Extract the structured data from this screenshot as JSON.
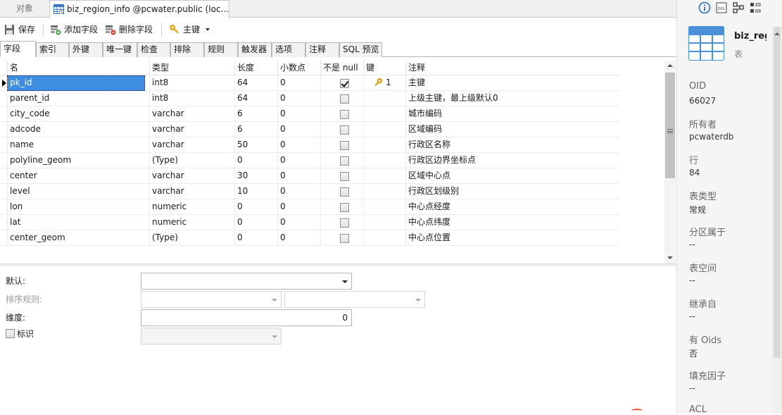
{
  "tabs": {
    "objects": "对象",
    "active": "biz_region_info @pcwater.public (loc..."
  },
  "toolbar": {
    "save": "保存",
    "add_field": "添加字段",
    "delete_field": "删除字段",
    "primary_key": "主键"
  },
  "subtabs": [
    "字段",
    "索引",
    "外键",
    "唯一键",
    "检查",
    "排除",
    "规则",
    "触发器",
    "选项",
    "注释",
    "SQL 预览"
  ],
  "grid": {
    "headers": [
      "名",
      "类型",
      "长度",
      "小数点",
      "不是 null",
      "键",
      "注释"
    ],
    "rows": [
      {
        "name": "pk_id",
        "type": "int8",
        "length": "64",
        "decimal": "0",
        "not_null": true,
        "key": "1",
        "comment": "主键"
      },
      {
        "name": "parent_id",
        "type": "int8",
        "length": "64",
        "decimal": "0",
        "not_null": false,
        "key": "",
        "comment": "上级主键，最上级默认0"
      },
      {
        "name": "city_code",
        "type": "varchar",
        "length": "6",
        "decimal": "0",
        "not_null": false,
        "key": "",
        "comment": "城市编码"
      },
      {
        "name": "adcode",
        "type": "varchar",
        "length": "6",
        "decimal": "0",
        "not_null": false,
        "key": "",
        "comment": "区域编码"
      },
      {
        "name": "name",
        "type": "varchar",
        "length": "50",
        "decimal": "0",
        "not_null": false,
        "key": "",
        "comment": "行政区名称"
      },
      {
        "name": "polyline_geom",
        "type": "(Type)",
        "length": "0",
        "decimal": "0",
        "not_null": false,
        "key": "",
        "comment": "行政区边界坐标点"
      },
      {
        "name": "center",
        "type": "varchar",
        "length": "30",
        "decimal": "0",
        "not_null": false,
        "key": "",
        "comment": "区域中心点"
      },
      {
        "name": "level",
        "type": "varchar",
        "length": "10",
        "decimal": "0",
        "not_null": false,
        "key": "",
        "comment": "行政区划级别"
      },
      {
        "name": "lon",
        "type": "numeric",
        "length": "0",
        "decimal": "0",
        "not_null": false,
        "key": "",
        "comment": "中心点经度"
      },
      {
        "name": "lat",
        "type": "numeric",
        "length": "0",
        "decimal": "0",
        "not_null": false,
        "key": "",
        "comment": "中心点纬度"
      },
      {
        "name": "center_geom",
        "type": "(Type)",
        "length": "0",
        "decimal": "0",
        "not_null": false,
        "key": "",
        "comment": "中心点位置"
      }
    ]
  },
  "props": {
    "default_label": "默认:",
    "collation_label": "排序规则:",
    "dimension_label": "维度:",
    "dimension_value": "0",
    "identity_label": "标识"
  },
  "info": {
    "object_name": "biz_region_info",
    "object_type": "表",
    "fields": [
      {
        "label": "OID",
        "value": "66027"
      },
      {
        "label": "所有者",
        "value": "pcwaterdb"
      },
      {
        "label": "行",
        "value": "84"
      },
      {
        "label": "表类型",
        "value": "常规"
      },
      {
        "label": "分区属于",
        "value": "--"
      },
      {
        "label": "表空间",
        "value": "--"
      },
      {
        "label": "继承自",
        "value": "--"
      },
      {
        "label": "有 Oids",
        "value": "否"
      },
      {
        "label": "填充因子",
        "value": "--"
      },
      {
        "label": "ACL",
        "value": ""
      }
    ]
  },
  "colors": {
    "selection": "#3d8ee0",
    "key_icon": "#d9a21a",
    "table_icon": "#4a90d9",
    "accent_mark": "#e84f2d"
  }
}
